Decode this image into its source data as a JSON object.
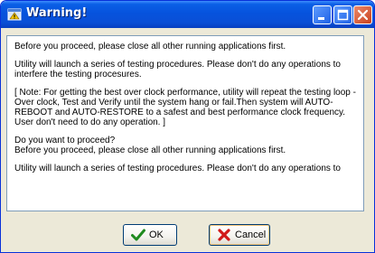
{
  "window": {
    "title": "Warning!"
  },
  "content": {
    "paragraphs": [
      "Before you proceed, please close all other running applications first.",
      "Utility will launch a series of testing procedures. Please don't do any operations to interfere the testing procesures.",
      "[ Note: For getting the best over clock performance, utility will repeat the testing loop - Over clock, Test and Verify until the system hang or fail.Then system will AUTO-REBOOT and AUTO-RESTORE to a safest and best performance clock frequency. User don't need to do any operation. ]",
      "Do you want to proceed?\nBefore you proceed, please close all other running applications first.",
      "Utility will launch a series of testing procedures. Please don't do any operations to"
    ]
  },
  "buttons": {
    "ok_label": "OK",
    "cancel_label": "Cancel"
  },
  "icons": {
    "window_icon": "warning-window-icon",
    "ok_icon": "green-checkmark-icon",
    "cancel_icon": "red-x-icon"
  },
  "colors": {
    "titlebar": "#0653DD",
    "dialog_background": "#ECE9D8",
    "close_button": "#C9411C"
  }
}
